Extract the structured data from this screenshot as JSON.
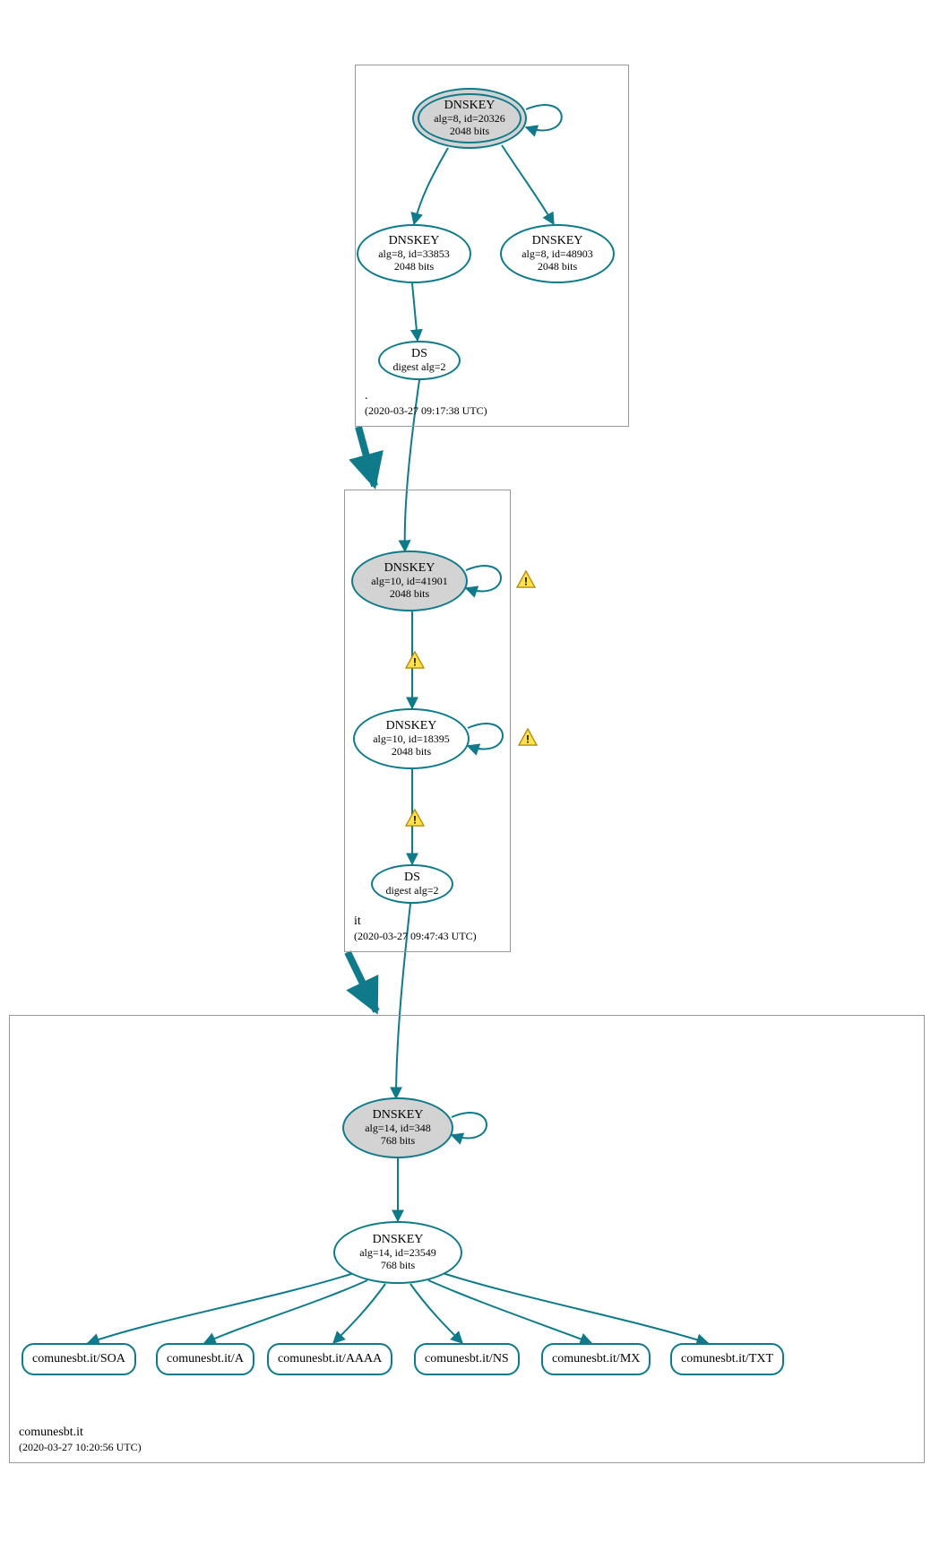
{
  "colors": {
    "stroke": "#0e7a8a",
    "warnFill": "#ffe24d",
    "warnStroke": "#b58a00"
  },
  "zones": {
    "root": {
      "name": ".",
      "timestamp": "(2020-03-27 09:17:38 UTC)"
    },
    "it": {
      "name": "it",
      "timestamp": "(2020-03-27 09:47:43 UTC)"
    },
    "domain": {
      "name": "comunesbt.it",
      "timestamp": "(2020-03-27 10:20:56 UTC)"
    }
  },
  "nodes": {
    "root_ksk": {
      "title": "DNSKEY",
      "sub1": "alg=8, id=20326",
      "sub2": "2048 bits"
    },
    "root_zsk": {
      "title": "DNSKEY",
      "sub1": "alg=8, id=33853",
      "sub2": "2048 bits"
    },
    "root_extra": {
      "title": "DNSKEY",
      "sub1": "alg=8, id=48903",
      "sub2": "2048 bits"
    },
    "root_ds": {
      "title": "DS",
      "sub1": "digest alg=2"
    },
    "it_ksk": {
      "title": "DNSKEY",
      "sub1": "alg=10, id=41901",
      "sub2": "2048 bits"
    },
    "it_zsk": {
      "title": "DNSKEY",
      "sub1": "alg=10, id=18395",
      "sub2": "2048 bits"
    },
    "it_ds": {
      "title": "DS",
      "sub1": "digest alg=2"
    },
    "dom_ksk": {
      "title": "DNSKEY",
      "sub1": "alg=14, id=348",
      "sub2": "768 bits"
    },
    "dom_zsk": {
      "title": "DNSKEY",
      "sub1": "alg=14, id=23549",
      "sub2": "768 bits"
    }
  },
  "records": {
    "soa": "comunesbt.it/SOA",
    "a": "comunesbt.it/A",
    "aaaa": "comunesbt.it/AAAA",
    "ns": "comunesbt.it/NS",
    "mx": "comunesbt.it/MX",
    "txt": "comunesbt.it/TXT"
  }
}
